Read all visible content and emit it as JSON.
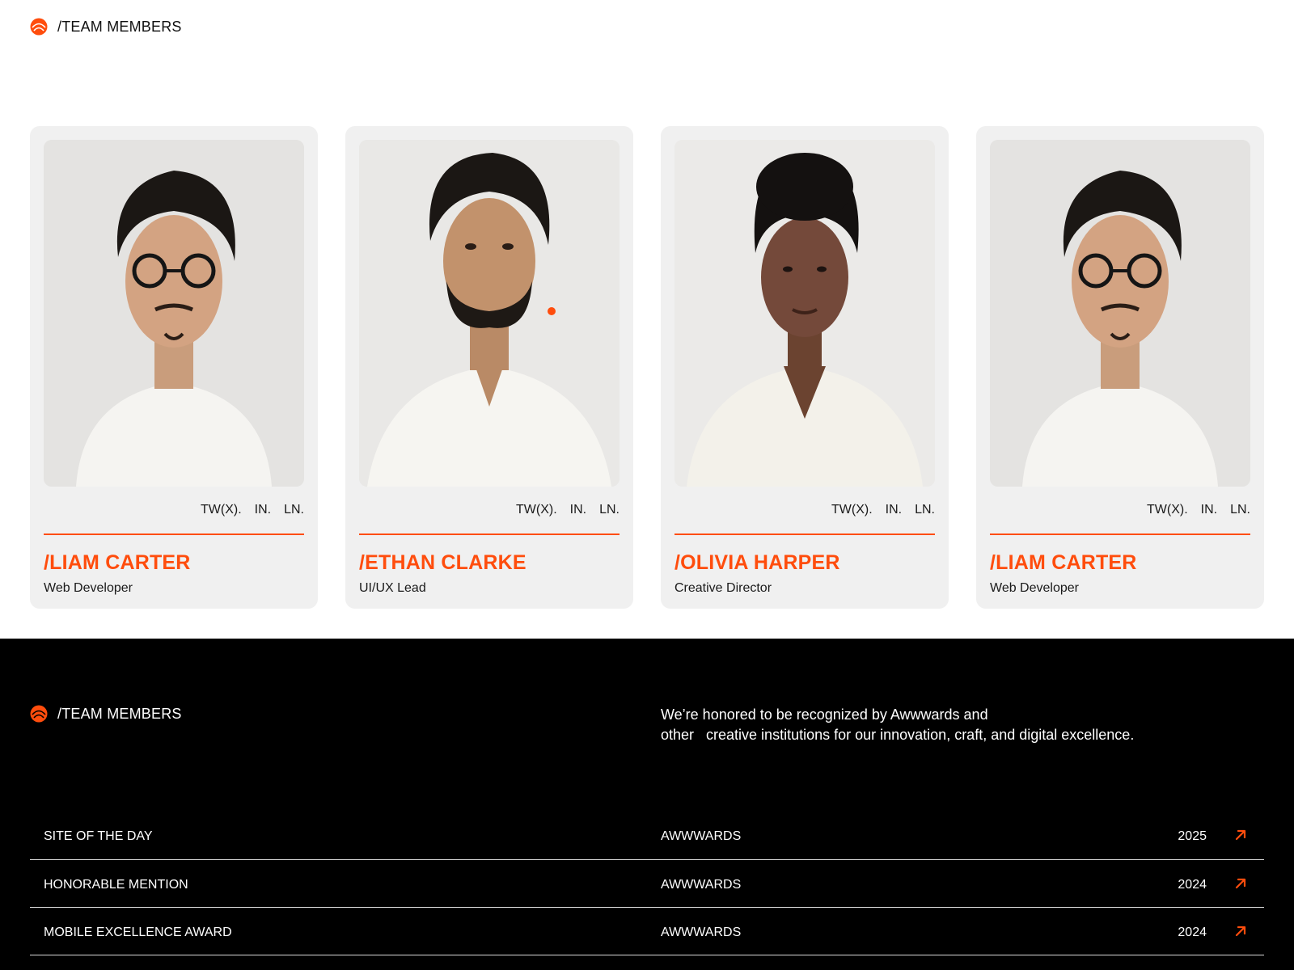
{
  "header": {
    "section_label": "/TEAM MEMBERS"
  },
  "team": [
    {
      "name": "/LIAM CARTER",
      "role": "Web Developer",
      "socials": [
        "TW(X).",
        "IN.",
        "LN."
      ],
      "photo": "man-glasses"
    },
    {
      "name": "/ETHAN CLARKE",
      "role": "UI/UX Lead",
      "socials": [
        "TW(X).",
        "IN.",
        "LN."
      ],
      "photo": "man-beard"
    },
    {
      "name": "/OLIVIA HARPER",
      "role": "Creative Director",
      "socials": [
        "TW(X).",
        "IN.",
        "LN."
      ],
      "photo": "woman"
    },
    {
      "name": "/LIAM CARTER",
      "role": "Web Developer",
      "socials": [
        "TW(X).",
        "IN.",
        "LN."
      ],
      "photo": "man-glasses"
    }
  ],
  "footer": {
    "section_label": "/TEAM MEMBERS",
    "honor_line1": "We’re honored to be recognized by Awwwards and",
    "honor_line2": "other   creative institutions for our innovation, craft, and digital excellence."
  },
  "awards": [
    {
      "title": "SITE OF THE DAY",
      "org": "AWWWARDS",
      "year": "2025",
      "icon": "arrow-up-right-icon"
    },
    {
      "title": "HONORABLE MENTION",
      "org": "AWWWARDS",
      "year": "2024",
      "icon": "arrow-up-right-icon"
    },
    {
      "title": "MOBILE EXCELLENCE AWARD",
      "org": "AWWWARDS",
      "year": "2024",
      "icon": "arrow-up-right-icon"
    }
  ],
  "colors": {
    "accent": "#ff4d0d",
    "card_bg": "#f0f0f0",
    "dark_bg": "#000000"
  }
}
